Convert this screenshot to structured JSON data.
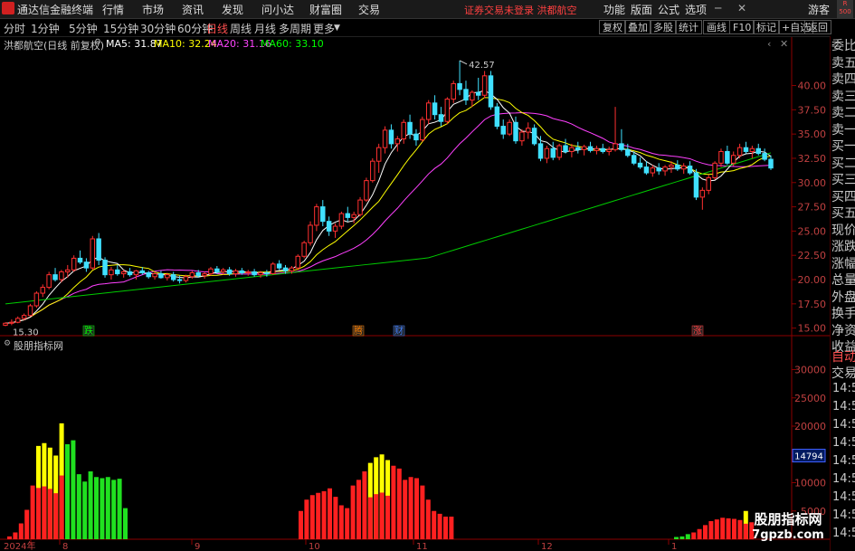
{
  "menubar": {
    "app_title": "通达信金融终端",
    "items": [
      "行情",
      "市场",
      "资讯",
      "发现",
      "问小达",
      "财富圈",
      "交易"
    ],
    "warning": "证券交易未登录  洪都航空",
    "right_items": [
      "功能",
      "版面",
      "公式",
      "选项"
    ],
    "guest": "游客",
    "r_badge_top": "R",
    "r_badge_bottom": "500"
  },
  "toolbar": {
    "periods": [
      "分时",
      "1分钟",
      "5分钟",
      "15分钟",
      "30分钟",
      "60分钟",
      "日线",
      "周线",
      "月线",
      "多周期",
      "更多"
    ],
    "active_period": "日线",
    "buttons": [
      "复权",
      "叠加",
      "多股",
      "统计",
      "画线",
      "F10",
      "标记",
      "+自选",
      "返回"
    ]
  },
  "ma_row": {
    "title": "洪都航空(日线 前复权)",
    "ma5": "MA5: 31.87",
    "ma10": "MA10: 32.24",
    "ma20": "MA20: 31.16",
    "ma60": "MA60: 33.10",
    "colors": {
      "ma5": "#ffffff",
      "ma10": "#ffff00",
      "ma20": "#ff40ff",
      "ma60": "#00ff00"
    }
  },
  "price_axis": [
    "40.00",
    "37.50",
    "35.00",
    "32.50",
    "30.00",
    "27.50",
    "25.00",
    "22.50",
    "20.00",
    "17.50",
    "15.00"
  ],
  "price_annotations": {
    "high": "42.57",
    "low": "15.30"
  },
  "event_markers": [
    {
      "label": "跌",
      "color": "#00ff00"
    },
    {
      "label": "腾",
      "color": "#ff8000"
    },
    {
      "label": "财",
      "color": "#4080ff"
    },
    {
      "label": "涨",
      "color": "#ff4040"
    }
  ],
  "indicator": {
    "name": "股朋指标网",
    "axis": [
      "30000",
      "25000",
      "20000",
      "15000",
      "10000",
      "5000"
    ],
    "current_value": "14794"
  },
  "x_axis": [
    "2024年",
    "8",
    "9",
    "10",
    "11",
    "12",
    "1"
  ],
  "right_panel": {
    "items": [
      "委比",
      "卖五",
      "卖四",
      "卖三",
      "卖二",
      "卖一",
      "买一",
      "买二",
      "买三",
      "买四",
      "买五",
      "现价",
      "涨跌",
      "涨幅",
      "总量",
      "外盘",
      "换手",
      "净资",
      "收益"
    ],
    "auto": "自动",
    "trade": "交易",
    "times": [
      "14:56",
      "14:56",
      "14:56",
      "14:56",
      "14:56",
      "14:56",
      "14:56",
      "14:56",
      "14:56"
    ]
  },
  "watermark": {
    "line1": "股朋指标网",
    "line2": "7gpzb.com"
  },
  "chart_data": {
    "type": "candlestick",
    "price_range": [
      14.5,
      43.5
    ],
    "candles": [
      [
        15.3,
        15.6,
        15.2,
        15.5
      ],
      [
        15.5,
        15.9,
        15.3,
        15.6
      ],
      [
        15.6,
        16.2,
        15.5,
        16.0
      ],
      [
        16.0,
        16.5,
        15.8,
        16.3
      ],
      [
        16.3,
        17.5,
        16.2,
        17.3
      ],
      [
        17.3,
        18.8,
        17.1,
        18.6
      ],
      [
        18.6,
        19.5,
        18.2,
        19.2
      ],
      [
        19.2,
        20.8,
        19.0,
        20.5
      ],
      [
        20.5,
        21.2,
        19.8,
        20.0
      ],
      [
        20.0,
        21.0,
        19.7,
        20.8
      ],
      [
        20.8,
        21.5,
        20.2,
        21.0
      ],
      [
        21.0,
        22.5,
        20.8,
        22.2
      ],
      [
        22.2,
        23.0,
        21.6,
        21.8
      ],
      [
        21.8,
        22.2,
        20.8,
        21.2
      ],
      [
        21.2,
        24.5,
        21.0,
        24.2
      ],
      [
        24.2,
        24.8,
        21.5,
        22.0
      ],
      [
        22.0,
        22.3,
        20.2,
        20.5
      ],
      [
        20.5,
        21.3,
        20.0,
        21.0
      ],
      [
        21.0,
        21.5,
        20.4,
        20.6
      ],
      [
        20.6,
        21.0,
        20.2,
        20.8
      ],
      [
        20.8,
        21.2,
        20.3,
        20.5
      ],
      [
        20.5,
        21.0,
        20.0,
        20.9
      ],
      [
        20.9,
        21.3,
        20.5,
        20.7
      ],
      [
        20.7,
        20.9,
        20.1,
        20.3
      ],
      [
        20.3,
        20.8,
        20.0,
        20.6
      ],
      [
        20.6,
        20.9,
        20.1,
        20.2
      ],
      [
        20.2,
        20.7,
        19.9,
        20.5
      ],
      [
        20.5,
        20.8,
        19.8,
        20.0
      ],
      [
        20.0,
        20.4,
        19.6,
        19.9
      ],
      [
        19.9,
        20.5,
        19.7,
        20.3
      ],
      [
        20.3,
        20.9,
        20.1,
        20.7
      ],
      [
        20.7,
        21.0,
        20.2,
        20.4
      ],
      [
        20.4,
        20.8,
        20.1,
        20.6
      ],
      [
        20.6,
        21.3,
        20.4,
        21.1
      ],
      [
        21.1,
        21.4,
        20.6,
        20.8
      ],
      [
        20.8,
        21.2,
        20.5,
        21.0
      ],
      [
        21.0,
        21.3,
        20.4,
        20.6
      ],
      [
        20.6,
        21.1,
        20.3,
        20.9
      ],
      [
        20.9,
        21.2,
        20.5,
        20.7
      ],
      [
        20.7,
        21.0,
        20.4,
        20.8
      ],
      [
        20.8,
        21.1,
        20.3,
        20.5
      ],
      [
        20.5,
        20.9,
        20.2,
        20.7
      ],
      [
        20.7,
        21.0,
        20.3,
        20.6
      ],
      [
        20.6,
        21.8,
        20.5,
        21.6
      ],
      [
        21.6,
        22.0,
        21.0,
        21.2
      ],
      [
        21.2,
        21.5,
        20.6,
        20.9
      ],
      [
        20.9,
        21.4,
        20.6,
        21.2
      ],
      [
        21.2,
        22.6,
        21.0,
        22.4
      ],
      [
        22.4,
        24.0,
        22.2,
        23.8
      ],
      [
        23.8,
        26.0,
        23.5,
        25.6
      ],
      [
        25.6,
        27.8,
        25.0,
        27.5
      ],
      [
        27.5,
        28.2,
        25.5,
        26.0
      ],
      [
        26.0,
        26.5,
        24.5,
        25.0
      ],
      [
        25.0,
        25.8,
        24.3,
        25.5
      ],
      [
        25.5,
        27.0,
        25.2,
        26.8
      ],
      [
        26.8,
        27.5,
        26.0,
        26.4
      ],
      [
        26.4,
        27.0,
        25.8,
        26.7
      ],
      [
        26.7,
        28.5,
        26.5,
        28.2
      ],
      [
        28.2,
        30.5,
        28.0,
        30.2
      ],
      [
        30.2,
        32.5,
        30.0,
        32.2
      ],
      [
        32.2,
        34.0,
        31.0,
        33.6
      ],
      [
        33.6,
        35.8,
        33.0,
        35.4
      ],
      [
        35.4,
        36.0,
        33.5,
        34.0
      ],
      [
        34.0,
        34.8,
        33.2,
        34.5
      ],
      [
        34.5,
        36.5,
        34.0,
        36.2
      ],
      [
        36.2,
        37.0,
        34.5,
        35.0
      ],
      [
        35.0,
        35.5,
        33.8,
        34.4
      ],
      [
        34.4,
        36.8,
        34.2,
        36.5
      ],
      [
        36.5,
        38.5,
        36.0,
        38.2
      ],
      [
        38.2,
        39.0,
        36.5,
        37.0
      ],
      [
        37.0,
        37.8,
        35.8,
        36.3
      ],
      [
        36.3,
        38.8,
        36.0,
        38.6
      ],
      [
        38.6,
        40.5,
        38.2,
        40.2
      ],
      [
        40.2,
        42.57,
        39.0,
        39.6
      ],
      [
        39.6,
        40.5,
        38.0,
        38.5
      ],
      [
        38.5,
        39.5,
        37.8,
        39.3
      ],
      [
        39.3,
        40.8,
        38.5,
        39.0
      ],
      [
        39.0,
        41.5,
        38.7,
        41.0
      ],
      [
        41.0,
        41.5,
        37.5,
        37.8
      ],
      [
        37.8,
        38.2,
        35.5,
        35.8
      ],
      [
        35.8,
        36.5,
        34.5,
        35.0
      ],
      [
        35.0,
        36.5,
        34.8,
        36.2
      ],
      [
        36.2,
        36.8,
        34.0,
        34.3
      ],
      [
        34.3,
        35.5,
        33.8,
        35.2
      ],
      [
        35.2,
        36.2,
        34.5,
        35.6
      ],
      [
        35.6,
        36.0,
        33.8,
        34.0
      ],
      [
        34.0,
        34.8,
        32.2,
        32.5
      ],
      [
        32.5,
        33.8,
        32.0,
        33.5
      ],
      [
        33.5,
        34.2,
        32.3,
        32.6
      ],
      [
        32.6,
        34.0,
        32.3,
        33.8
      ],
      [
        33.8,
        34.5,
        33.0,
        33.2
      ],
      [
        33.2,
        34.0,
        32.6,
        33.6
      ],
      [
        33.6,
        34.2,
        33.0,
        33.4
      ],
      [
        33.4,
        33.9,
        32.8,
        33.7
      ],
      [
        33.7,
        34.2,
        33.1,
        33.3
      ],
      [
        33.3,
        33.8,
        32.9,
        33.5
      ],
      [
        33.5,
        34.0,
        33.0,
        33.2
      ],
      [
        33.2,
        33.7,
        32.8,
        33.4
      ],
      [
        33.4,
        37.8,
        33.2,
        34.0
      ],
      [
        34.0,
        35.5,
        33.2,
        33.4
      ],
      [
        33.4,
        34.0,
        32.6,
        32.8
      ],
      [
        32.8,
        33.2,
        31.8,
        32.0
      ],
      [
        32.0,
        32.6,
        31.4,
        31.6
      ],
      [
        31.6,
        32.2,
        30.8,
        31.0
      ],
      [
        31.0,
        31.8,
        30.6,
        31.5
      ],
      [
        31.5,
        32.0,
        30.8,
        31.2
      ],
      [
        31.2,
        31.8,
        30.7,
        31.6
      ],
      [
        31.6,
        32.2,
        31.0,
        31.8
      ],
      [
        31.8,
        32.3,
        31.2,
        31.4
      ],
      [
        31.4,
        32.0,
        30.9,
        31.7
      ],
      [
        31.7,
        32.2,
        30.8,
        31.0
      ],
      [
        31.0,
        31.4,
        28.2,
        28.5
      ],
      [
        28.5,
        29.5,
        27.2,
        29.2
      ],
      [
        29.2,
        30.8,
        28.8,
        30.5
      ],
      [
        30.5,
        32.2,
        30.3,
        32.0
      ],
      [
        32.0,
        33.5,
        31.6,
        33.2
      ],
      [
        33.2,
        33.8,
        31.8,
        32.0
      ],
      [
        32.0,
        33.2,
        31.7,
        32.8
      ],
      [
        32.8,
        34.0,
        32.5,
        33.6
      ],
      [
        33.6,
        34.2,
        33.0,
        33.2
      ],
      [
        33.2,
        33.8,
        32.5,
        33.5
      ],
      [
        33.5,
        34.0,
        32.8,
        33.0
      ],
      [
        33.0,
        33.5,
        32.2,
        32.4
      ],
      [
        32.4,
        32.8,
        31.3,
        31.5
      ]
    ],
    "volume": [
      500,
      1200,
      2800,
      5200,
      9500,
      16500,
      17000,
      16200,
      14800,
      20500,
      16800,
      17500,
      11500,
      10200,
      12000,
      11000,
      10800,
      11000,
      10500,
      10700,
      5500
    ],
    "ma60_start": 17.5,
    "ma60_end": 33.1
  }
}
